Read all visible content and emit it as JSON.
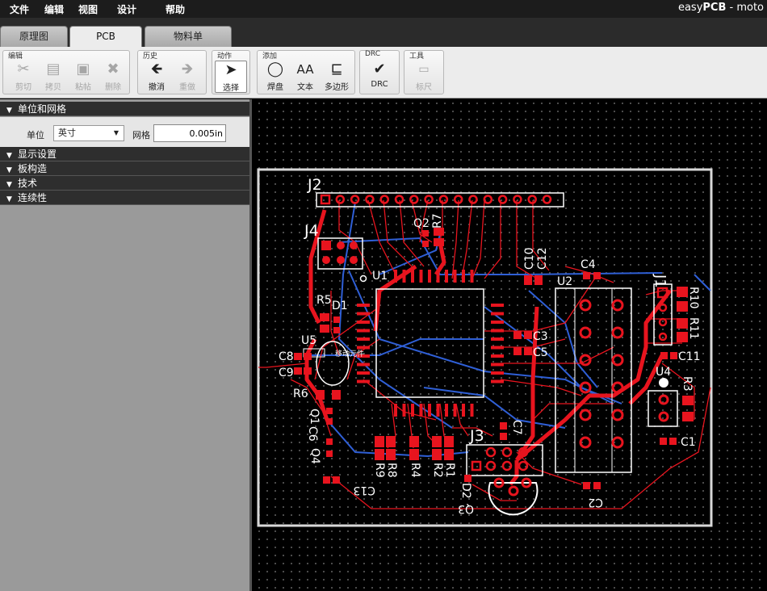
{
  "menu": {
    "file": "文件",
    "edit": "编辑",
    "view": "视图",
    "design": "设计",
    "help": "帮助"
  },
  "brand": {
    "prefix": "easy",
    "bold": "PCB",
    "suffix": " - moto"
  },
  "tabs": [
    {
      "label": "原理图"
    },
    {
      "label": "PCB"
    },
    {
      "label": "物料单"
    }
  ],
  "toolbar": {
    "edit": {
      "title": "编辑",
      "cut": "剪切",
      "copy": "拷贝",
      "paste": "粘帖",
      "delete": "删除"
    },
    "history": {
      "title": "历史",
      "undo": "撤消",
      "redo": "重做"
    },
    "action": {
      "title": "动作",
      "select": "选择"
    },
    "add": {
      "title": "添加",
      "pad": "焊盘",
      "text": "文本",
      "polygon": "多边形"
    },
    "drc": {
      "title": "DRC",
      "drc": "DRC"
    },
    "tools": {
      "title": "工具",
      "ruler": "标尺"
    }
  },
  "panel": {
    "units_grid": "单位和网格",
    "unit_label": "单位",
    "unit_value": "英寸",
    "grid_label": "网格",
    "grid_value": "0.005in",
    "display": "显示设置",
    "board": "板构造",
    "technology": "技术",
    "connectivity": "连续性"
  },
  "pcb": {
    "tooltip": "移动元件",
    "refs": {
      "J2": "J2",
      "J4": "J4",
      "Q2": "Q2",
      "R7": "R7",
      "U1": "U1",
      "C10": "C10",
      "C12": "C12",
      "C4": "C4",
      "U2": "U2",
      "J1": "J1",
      "R10": "R10",
      "R11": "R11",
      "R5": "R5",
      "D1": "D1",
      "U5": "U5",
      "C8": "C8",
      "C9": "C9",
      "R6": "R6",
      "C3": "C3",
      "C5": "C5",
      "C11": "C11",
      "U4": "U4",
      "R3": "R3",
      "Q1": "Q1",
      "C6": "C6",
      "C7": "C7",
      "J3": "J3",
      "C1": "C1",
      "Q4": "Q4",
      "C13": "C13",
      "R9": "R9",
      "R8": "R8",
      "R4": "R4",
      "R2": "R2",
      "R1": "R1",
      "D2": "D2",
      "Q3": "Q3",
      "C2": "C2"
    }
  },
  "colors": {
    "copper_top": "#e8141e",
    "copper_bottom": "#2f5fd6",
    "silk": "#ffffff",
    "board_outline": "#d8d8d8"
  }
}
